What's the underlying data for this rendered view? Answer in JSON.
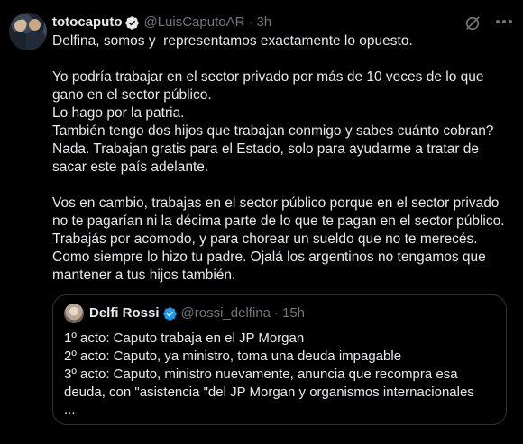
{
  "tweet": {
    "display_name": "totocaputo",
    "handle": "@LuisCaputoAR",
    "separator": "·",
    "time": "3h",
    "text": "Delfina, somos y  representamos exactamente lo opuesto.\n\nYo podría trabajar en el sector privado por más de 10 veces de lo que gano en el sector público.\nLo hago por la patria.\nTambién tengo dos hijos que trabajan conmigo y sabes cuánto cobran? Nada. Trabajan gratis para el Estado, solo para ayudarme a tratar de sacar este país adelante.\n\nVos en cambio, trabajas en el sector público porque en el sector privado no te pagarían ni la décima parte de lo que te pagan en el sector público. Trabajás por acomodo, y para chorear un sueldo que no te merecés. Como siempre lo hizo tu padre. Ojalá los argentinos no tengamos que mantener a tus hijos también."
  },
  "quote": {
    "display_name": "Delfi Rossi",
    "handle": "@rossi_delfina",
    "separator": "·",
    "time": "15h",
    "text": "1º acto: Caputo trabaja en el JP Morgan\n2º acto: Caputo, ya ministro, toma una deuda impagable\n3º acto: Caputo, ministro nuevamente, anuncia que recompra esa deuda, con \"asistencia \"del JP Morgan y organismos internacionales\n..."
  },
  "colors": {
    "background": "#000000",
    "text": "#e7e9ea",
    "muted": "#71767b",
    "verified": "#1d9bf0",
    "border": "#2f3336"
  },
  "icons": [
    "verified-badge-icon",
    "grok-icon",
    "more-icon"
  ]
}
